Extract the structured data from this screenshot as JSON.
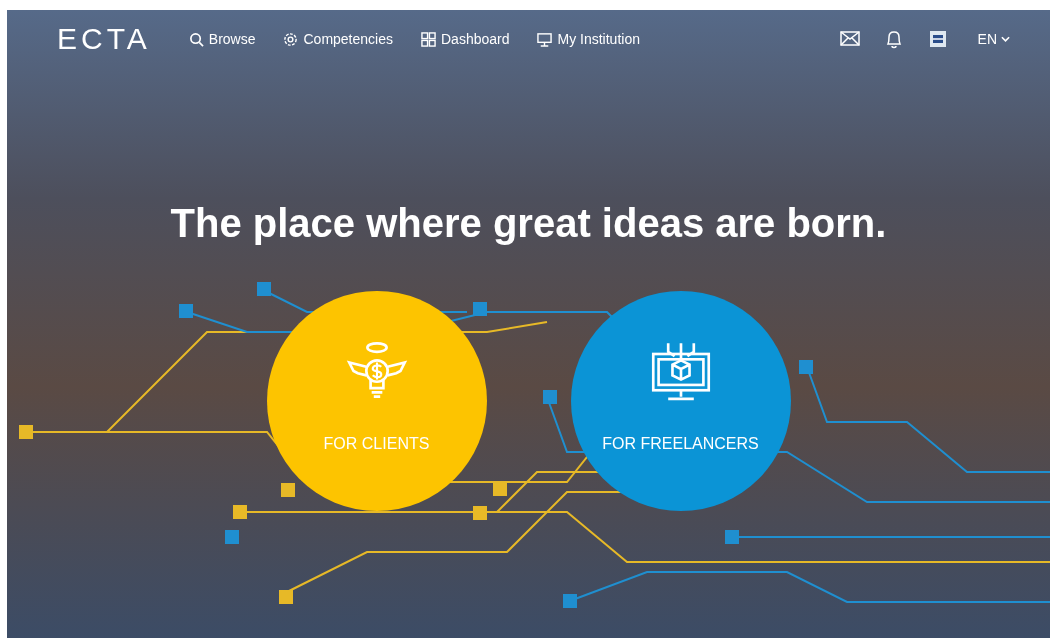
{
  "logo": {
    "text": "ECTA"
  },
  "nav": [
    {
      "label": "Browse",
      "kind": "search"
    },
    {
      "label": "Competencies",
      "kind": "network"
    },
    {
      "label": "Dashboard",
      "kind": "grid"
    },
    {
      "label": "My Institution",
      "kind": "monitor"
    }
  ],
  "actions": [
    {
      "kind": "mail"
    },
    {
      "kind": "bell"
    },
    {
      "kind": "flag"
    }
  ],
  "language": {
    "label": "EN"
  },
  "headline": "The place where great ideas are born.",
  "cards": [
    {
      "label": "FOR CLIENTS",
      "kind": "clients",
      "color": "#fdc400"
    },
    {
      "label": "FOR FREELANCERS",
      "kind": "freelancers",
      "color": "#0b94d6"
    }
  ]
}
